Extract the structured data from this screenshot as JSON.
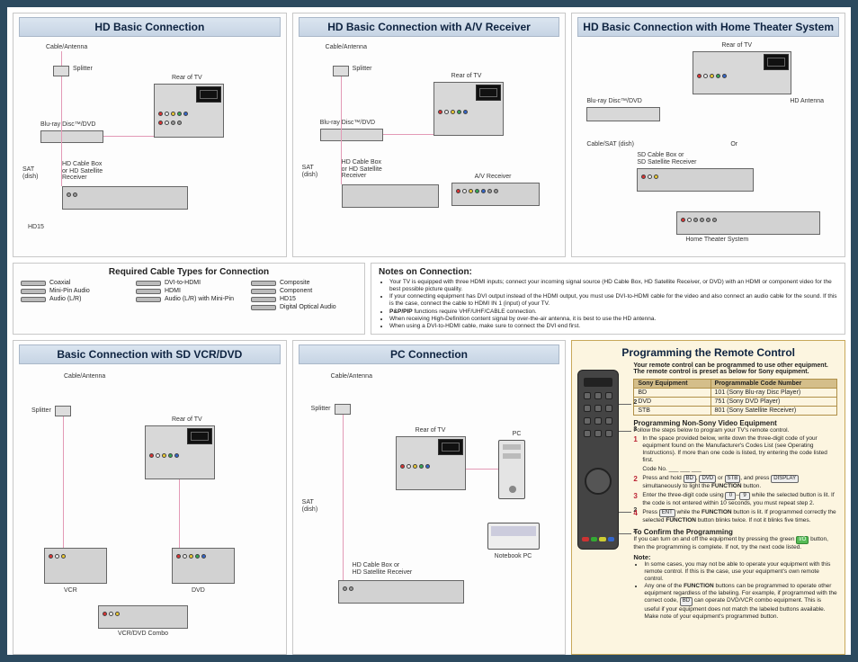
{
  "top": {
    "panels": [
      {
        "title": "HD Basic Connection",
        "labels": {
          "cable": "Cable/Antenna",
          "splitter": "Splitter",
          "rear": "Rear of TV",
          "bd": "Blu-ray Disc™/DVD",
          "sat": "SAT\n(dish)",
          "cablebox": "HD Cable Box\nor HD Satellite\nReceiver",
          "hd15": "HD15"
        }
      },
      {
        "title": "HD Basic Connection with A/V Receiver",
        "labels": {
          "cable": "Cable/Antenna",
          "splitter": "Splitter",
          "rear": "Rear of TV",
          "bd": "Blu-ray Disc™/DVD",
          "sat": "SAT\n(dish)",
          "cablebox": "HD Cable Box\nor HD Satellite\nReceiver",
          "avr": "A/V Receiver"
        }
      },
      {
        "title": "HD Basic Connection with Home Theater System",
        "labels": {
          "rear": "Rear of TV",
          "hdant": "HD Antenna",
          "bd": "Blu-ray Disc™/DVD",
          "cablesat": "Cable/SAT (dish)",
          "or": "Or",
          "sdbox": "SD Cable Box or\nSD Satellite Receiver",
          "hts": "Home Theater System"
        }
      }
    ]
  },
  "strip": {
    "required_title": "Required Cable Types for Connection",
    "cables": [
      {
        "name": "Coaxial"
      },
      {
        "name": "DVI-to-HDMI"
      },
      {
        "name": "Composite"
      },
      {
        "name": "Mini-Pin Audio"
      },
      {
        "name": "HDMI"
      },
      {
        "name": "Component"
      },
      {
        "name": "Audio (L/R)"
      },
      {
        "name": "Audio (L/R) with Mini-Pin"
      },
      {
        "name": "HD15"
      },
      {
        "name": ""
      },
      {
        "name": ""
      },
      {
        "name": "Digital Optical Audio"
      }
    ],
    "notes_title": "Notes on Connection:",
    "notes": [
      "Your TV is equipped with three HDMI inputs; connect your incoming signal source (HD Cable Box, HD Satellite Receiver, or DVD) with an HDMI or component video for the best possible picture quality.",
      "If your connecting equipment has DVI output instead of the HDMI output, you must use DVI-to-HDMI cable for the video and also connect an audio cable for the sound. If this is the case, connect the cable to HDMI IN 1 (input) of your TV.",
      "P&P/PIP functions require VHF/UHF/CABLE connection.",
      "When receiving High-Definition content signal by over-the-air antenna, it is best to use the HD antenna.",
      "When using a DVI-to-HDMI cable, make sure to connect the DVI end first."
    ]
  },
  "bottom": {
    "panels": [
      {
        "title": "Basic Connection with SD VCR/DVD",
        "labels": {
          "cable": "Cable/Antenna",
          "splitter": "Splitter",
          "rear": "Rear of TV",
          "vcr": "VCR",
          "dvd": "DVD",
          "combo": "VCR/DVD Combo"
        }
      },
      {
        "title": "PC Connection",
        "labels": {
          "cable": "Cable/Antenna",
          "splitter": "Splitter",
          "rear": "Rear of TV",
          "sat": "SAT\n(dish)",
          "cablebox": "HD Cable Box or\nHD Satellite Receiver",
          "pc": "PC",
          "nb": "Notebook PC"
        }
      }
    ]
  },
  "prog": {
    "title": "Programming the Remote Control",
    "intro": "Your remote control can be programmed to use other equipment. The remote control is preset as below for Sony equipment.",
    "table": {
      "head": [
        "Sony Equipment",
        "Programmable Code Number"
      ],
      "rows": [
        [
          "BD",
          "101 (Sony Blu-ray Disc Player)"
        ],
        [
          "DVD",
          "751 (Sony DVD Player)"
        ],
        [
          "STB",
          "801 (Sony Satellite Receiver)"
        ]
      ]
    },
    "leaders": [
      "2",
      "3",
      "2",
      "4"
    ],
    "sub_title": "Programming Non-Sony Video Equipment",
    "sub_intro": "Follow the steps below to program your TV's remote control.",
    "steps": [
      "In the space provided below, write down the three-digit code of your equipment found on the Manufacturer's Codes List (see Operating Instructions). If more than one code is listed, try entering the code listed first.",
      "Press and hold [BD], [DVD] or [STB], and press [DISPLAY] simultaneously to light the FUNCTION button.",
      "Enter the three-digit code using [0]–[9] while the selected button is lit. If the code is not entered within 10 seconds, you must repeat step 2.",
      "Press [ENT] while the FUNCTION button is lit. If programmed correctly the selected FUNCTION button blinks twice. If not it blinks five times."
    ],
    "codeline": "Code No. ___  ___  ___",
    "confirm_title": "To Confirm the Programming",
    "confirm_text": "If you can turn on and off the equipment by pressing the green [I/O] button, then the programming is complete. If not, try the next code listed.",
    "note_title": "Note:",
    "notes": [
      "In some cases, you may not be able to operate your equipment with this remote control. If this is the case, use your equipment's own remote control.",
      "Any one of the FUNCTION buttons can be programmed to operate other equipment regardless of the labeling. For example, if programmed with the correct code, [BD] can operate DVD/VCR combo equipment. This is useful if your equipment does not match the labeled buttons available. Make note of your equipment's programmed button."
    ]
  }
}
